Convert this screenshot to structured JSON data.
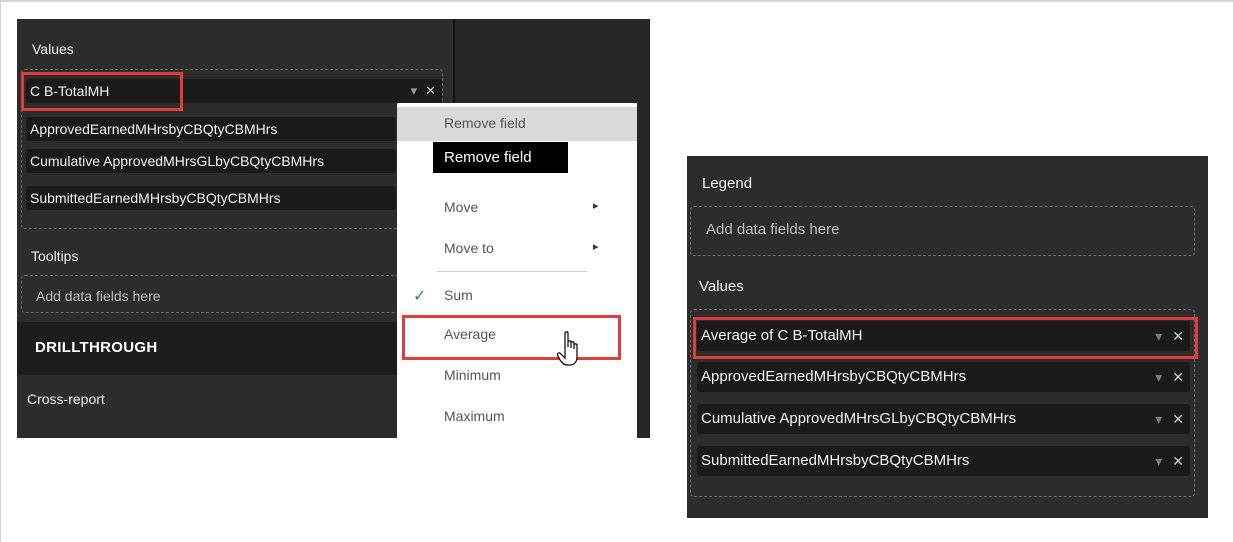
{
  "left_panel": {
    "values_label": "Values",
    "value_fields": [
      {
        "label": "C B-TotalMH"
      },
      {
        "label": "ApprovedEarnedMHrsbyCBQtyCBMHrs"
      },
      {
        "label": "Cumulative ApprovedMHrsGLbyCBQtyCBMHrs"
      },
      {
        "label": "SubmittedEarnedMHrsbyCBQtyCBMHrs"
      }
    ],
    "tooltips_label": "Tooltips",
    "tooltips_placeholder": "Add data fields here",
    "drillthrough_label": "DRILLTHROUGH",
    "cross_report_label": "Cross-report"
  },
  "context_menu": {
    "items": [
      {
        "label": "Remove field"
      },
      {
        "label": "Move"
      },
      {
        "label": "Move to"
      },
      {
        "label": "Sum"
      },
      {
        "label": "Average"
      },
      {
        "label": "Minimum"
      },
      {
        "label": "Maximum"
      }
    ],
    "tooltip": "Remove field",
    "checked_item": "Sum",
    "check_color": "#2e8b57"
  },
  "right_panel": {
    "legend_label": "Legend",
    "legend_placeholder": "Add data fields here",
    "values_label": "Values",
    "value_fields": [
      {
        "label": "Average of C B-TotalMH"
      },
      {
        "label": "ApprovedEarnedMHrsbyCBQtyCBMHrs"
      },
      {
        "label": "Cumulative ApprovedMHrsGLbyCBQtyCBMHrs"
      },
      {
        "label": "SubmittedEarnedMHrsbyCBQtyCBMHrs"
      }
    ]
  },
  "icons": {
    "dropdown": "▾",
    "remove": "✕",
    "submenu": "▸",
    "check": "✓"
  },
  "colors": {
    "highlight_box": "#e03c3c",
    "panel_bg": "#2c2c2c",
    "pill_bg": "#1a1a1a"
  }
}
